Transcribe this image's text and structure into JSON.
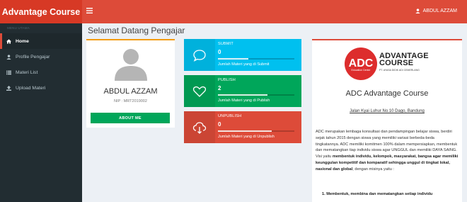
{
  "header": {
    "brand": "Advantage Course",
    "toggle_icon": "bars-icon",
    "user_name": "ABDUL AZZAM",
    "user_icon": "user-icon"
  },
  "sidebar": {
    "menu_header": "MENU UTAMA",
    "items": [
      {
        "label": "Home",
        "icon": "home-icon",
        "active": true
      },
      {
        "label": "Profile Pengajar",
        "icon": "user-icon",
        "active": false
      },
      {
        "label": "Materi List",
        "icon": "list-icon",
        "active": false
      },
      {
        "label": "Upload Materi",
        "icon": "upload-icon",
        "active": false
      }
    ]
  },
  "page": {
    "title": "Selamat Datang Pengajar"
  },
  "profile": {
    "name": "ABDUL AZZAM",
    "nip": "NIP : MRT2019002",
    "about_label": "ABOUT ME"
  },
  "stats": [
    {
      "label": "SUBMIT",
      "value": "0",
      "progress": 0.4,
      "desc": "Jumlah Materi yang di Submit",
      "color": "#00c0ef",
      "icon": "chat-bubble-icon"
    },
    {
      "label": "PUBLISH",
      "value": "2",
      "progress": 0.65,
      "desc": "Jumlah Materi yang di Publish",
      "color": "#00a65a",
      "icon": "heart-icon"
    },
    {
      "label": "UNPUBLISH",
      "value": "0",
      "progress": 0.7,
      "desc": "Jumlah Materi yang di Unpublish",
      "color": "#dd4b39",
      "icon": "cloud-download-icon"
    }
  ],
  "info": {
    "logo_text": "ADC",
    "logo_sub": "Education Center",
    "logo_name_1": "ADVANTAGE",
    "logo_name_2": "COURSE",
    "logo_tagline": "PT. AYASA DIDIK ADI CEMERLANG",
    "title": "ADC Advantage Course",
    "address": "Jalan Kyai Luhur No.10 Dago, Bandung",
    "para_1": "ADC merupakan lembaga konsultasi dan pendampingan belajar siswa, berdiri sejak tahun 2015 dengan siswa yang memiliki variasi berbeda-beda tingkatannya. ADC memiliki komitmen 100% dalam mempersiapkan, membentuk dan mematangkan tiap individu siswa agar UNGGUL dan memiliki DAYA SAING.",
    "para_2_intro": "Visi yaitu ",
    "para_2_bold": "membentuk individu, kelompok, masyarakat, bangsa agar memiliki keunggulan kompetitif dan komparatif sehingga unggul di tingkat lokal, nasional dan global",
    "para_2_end": ", dengan misinya yaitu :",
    "list_item_1": "1. Membentuk, membina dan mematangkan setiap individu"
  },
  "colors": {
    "header": "#dd4b39",
    "header_dark": "#d73925",
    "sidebar": "#222d32",
    "green": "#00a65a",
    "cyan": "#00c0ef",
    "red": "#dd4b39",
    "orange_accent": "#f39c12"
  }
}
